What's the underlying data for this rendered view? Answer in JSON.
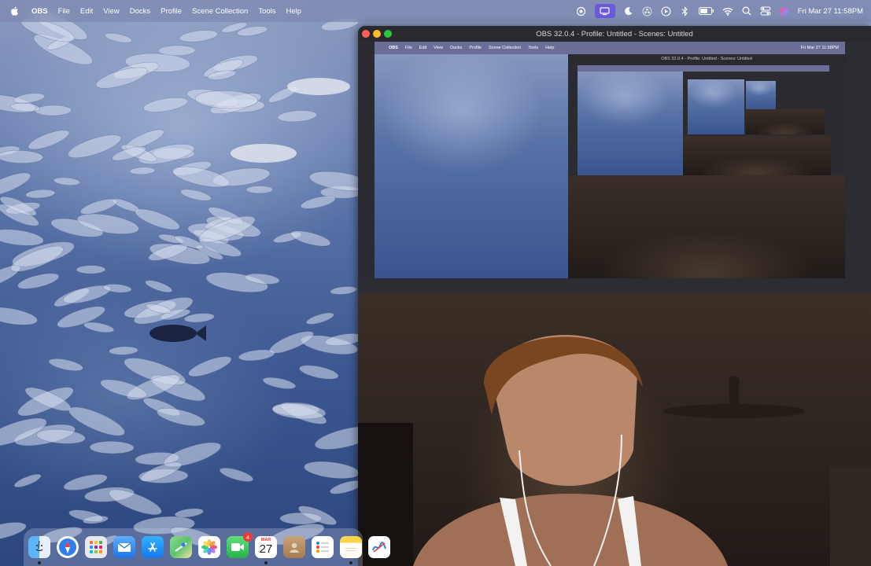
{
  "menubar": {
    "app_name": "OBS",
    "items": [
      "File",
      "Edit",
      "View",
      "Docks",
      "Profile",
      "Scene Collection",
      "Tools",
      "Help"
    ],
    "status_icons": [
      "camera-icon",
      "screen-mirroring-icon",
      "focus-moon-icon",
      "obs-icon",
      "play-icon",
      "bluetooth-icon",
      "battery-icon",
      "wifi-icon",
      "search-icon",
      "control-center-icon",
      "siri-icon"
    ],
    "clock": "Fri Mar 27  11:58PM"
  },
  "obs_window": {
    "title": "OBS 32.0.4 - Profile: Untitled - Scenes: Untitled"
  },
  "dock": {
    "apps": [
      {
        "name": "finder-icon",
        "color": "#3a8bf5"
      },
      {
        "name": "safari-icon",
        "color": "#2f7ef0"
      },
      {
        "name": "launchpad-icon",
        "color": "#d8d8e2"
      },
      {
        "name": "mail-icon",
        "color": "#3a8ff7"
      },
      {
        "name": "app-store-icon",
        "color": "#1e8cf2"
      },
      {
        "name": "maps-icon",
        "color": "#5bc26a"
      },
      {
        "name": "photos-icon",
        "color": "#ffffff"
      },
      {
        "name": "facetime-icon",
        "color": "#34c759"
      },
      {
        "name": "calendar-icon",
        "color": "#ffffff"
      },
      {
        "name": "contacts-icon",
        "color": "#b88a5a"
      },
      {
        "name": "reminders-icon",
        "color": "#ffffff"
      },
      {
        "name": "notes-icon",
        "color": "#fcd44b"
      },
      {
        "name": "freeform-icon",
        "color": "#ffffff"
      }
    ],
    "facetime_badge": "4",
    "calendar_month": "MAR",
    "calendar_day": "27"
  }
}
